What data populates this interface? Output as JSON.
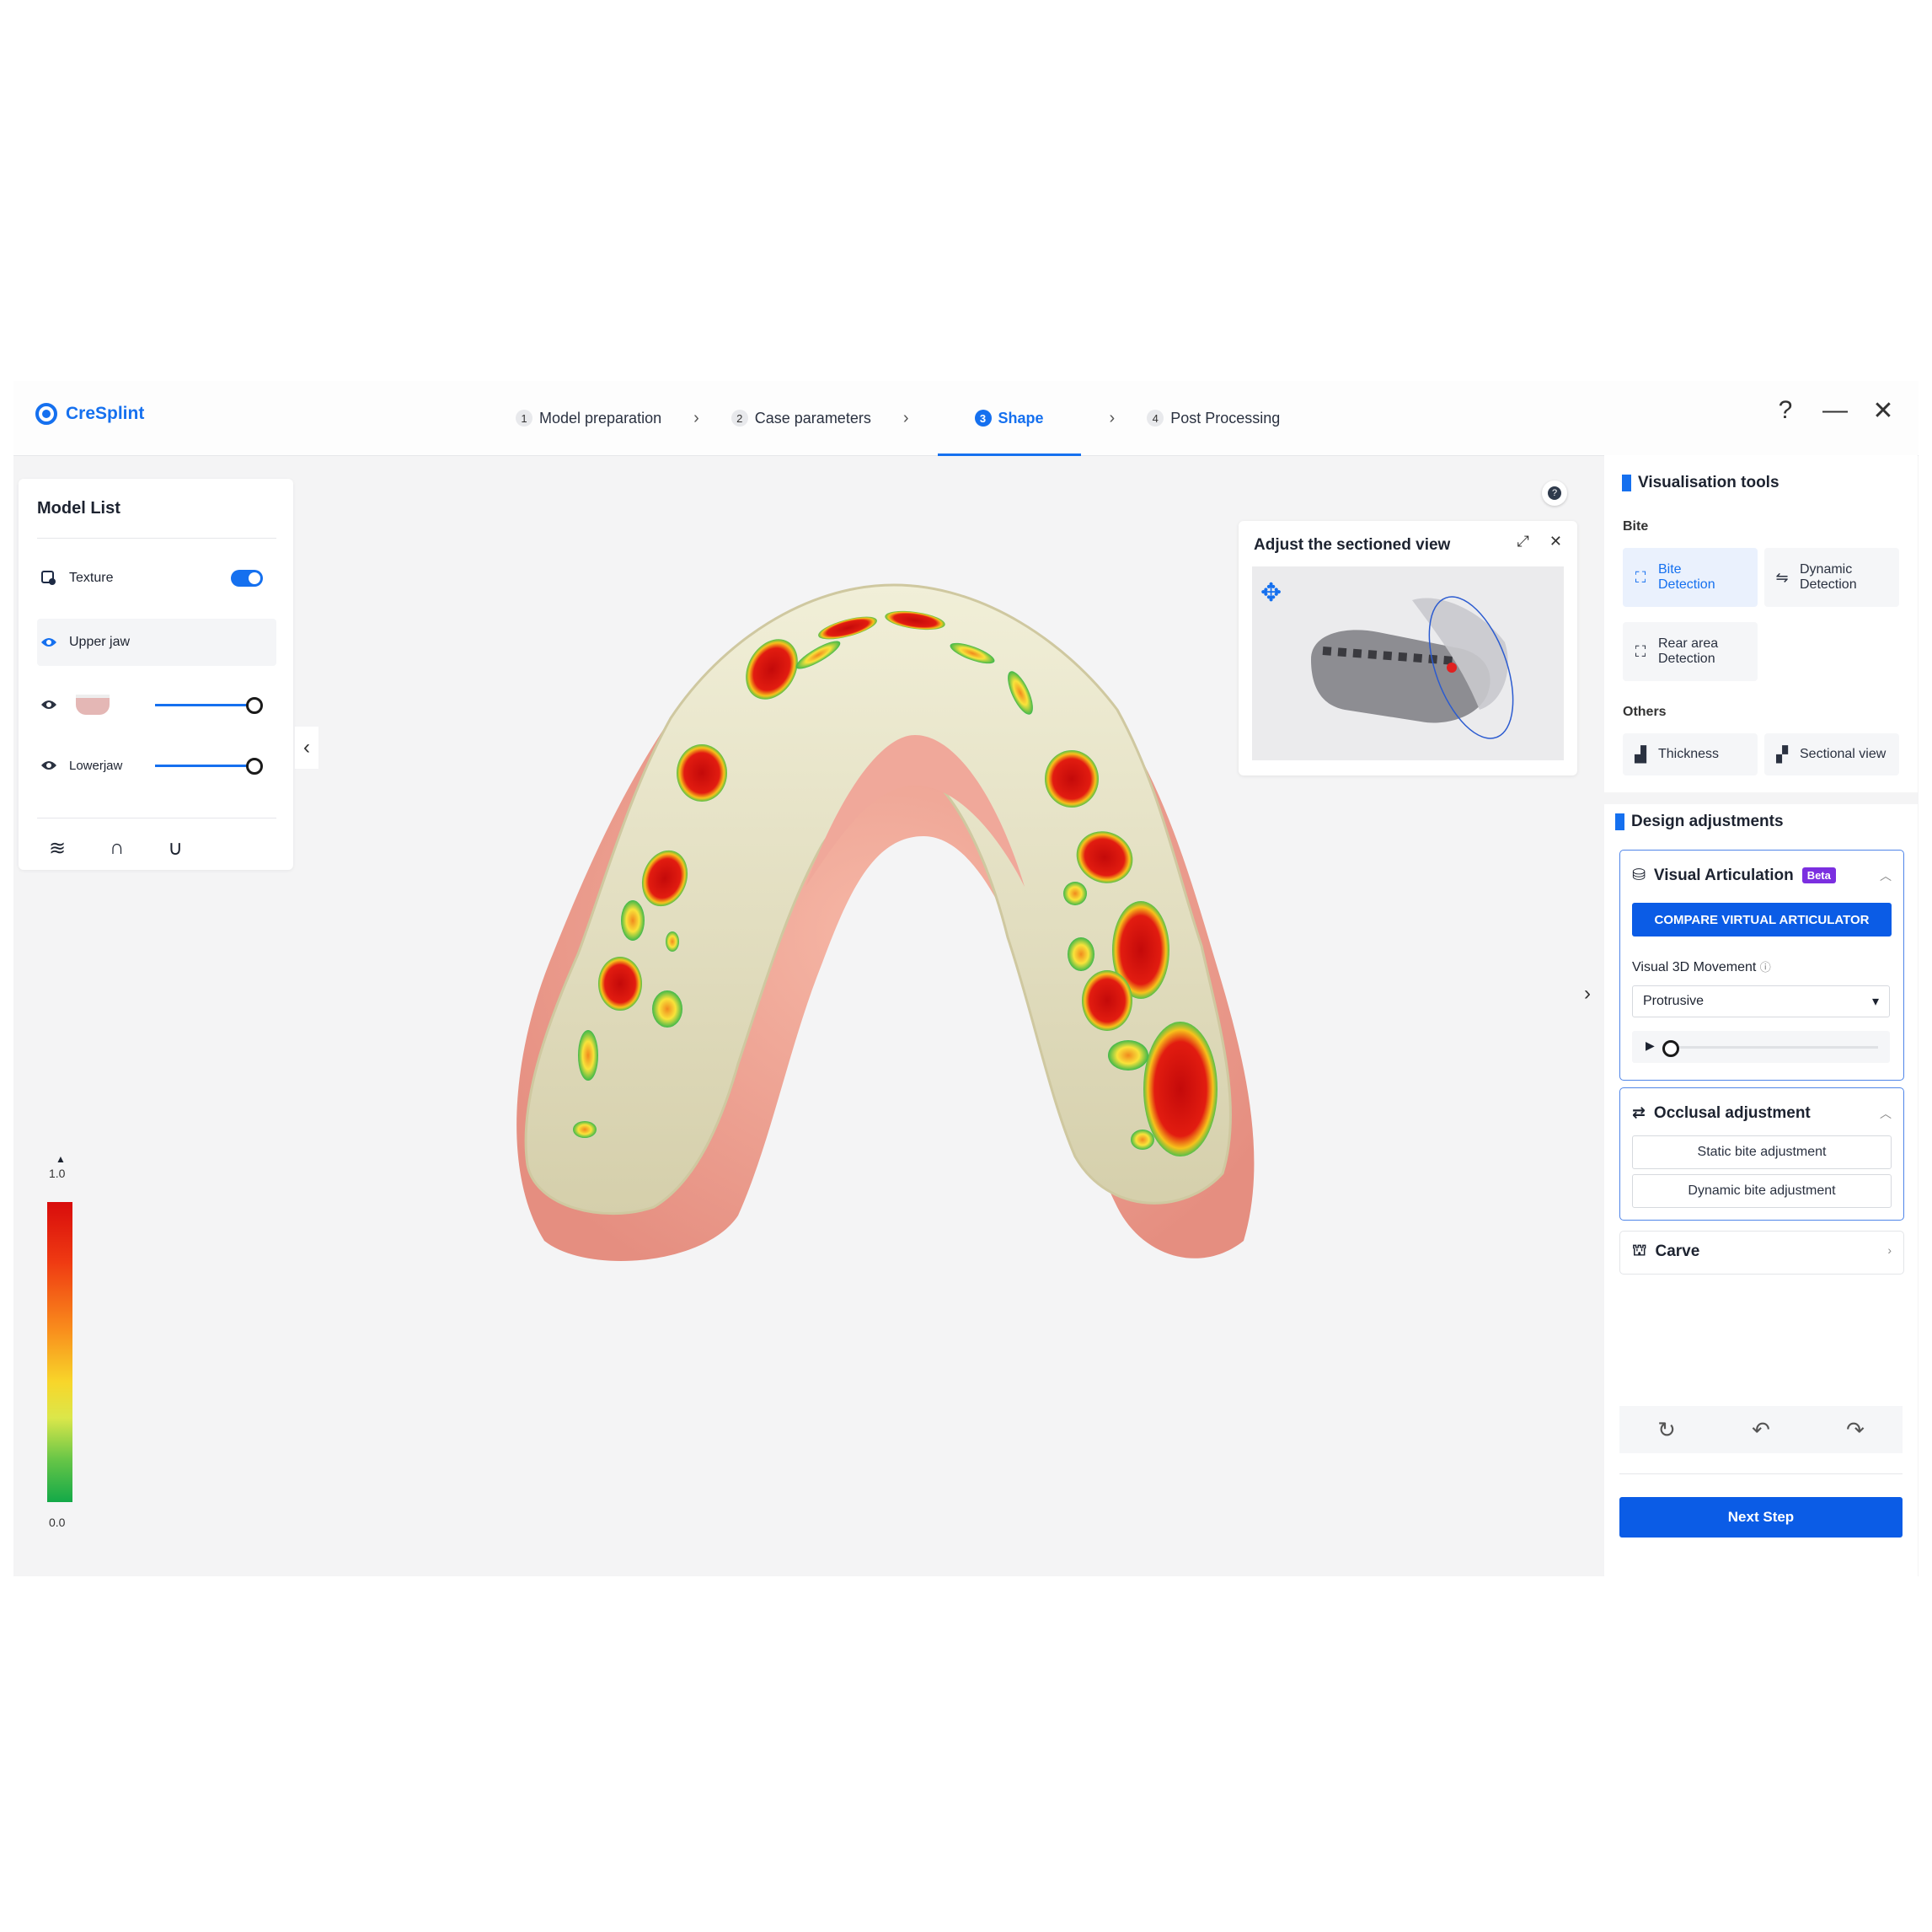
{
  "app": {
    "name": "CreSplint"
  },
  "steps": [
    {
      "num": "1",
      "label": "Model preparation"
    },
    {
      "num": "2",
      "label": "Case parameters"
    },
    {
      "num": "3",
      "label": "Shape"
    },
    {
      "num": "4",
      "label": "Post Processing"
    }
  ],
  "active_step": 3,
  "window_controls": {
    "help": "?",
    "minimize": "—",
    "close": "✕"
  },
  "model_list": {
    "title": "Model List",
    "texture_label": "Texture",
    "texture_on": true,
    "upper_jaw_label": "Upper jaw",
    "lower_jaw_label": "Lowerjaw",
    "upper_opacity": 1.0,
    "lower_opacity": 1.0
  },
  "sectioned_view": {
    "title": "Adjust the sectioned view"
  },
  "visualisation": {
    "title": "Visualisation tools",
    "bite_label": "Bite",
    "bite_detection": [
      "Bite",
      "Detection"
    ],
    "dynamic_detection": [
      "Dynamic",
      "Detection"
    ],
    "rear_area_detection": [
      "Rear area",
      "Detection"
    ],
    "others_label": "Others",
    "thickness": "Thickness",
    "sectional_view": "Sectional view"
  },
  "design": {
    "title": "Design adjustments",
    "visual_articulation": "Visual Articulation",
    "beta": "Beta",
    "compare_button": "COMPARE VIRTUAL ARTICULATOR",
    "movement_label": "Visual 3D Movement",
    "movement_value": "Protrusive",
    "movement_progress": 0,
    "occlusal_title": "Occlusal adjustment",
    "static_bite": "Static bite adjustment",
    "dynamic_bite": "Dynamic bite adjustment",
    "carve": "Carve"
  },
  "next_step": "Next Step",
  "legend": {
    "max": "1.0",
    "min": "0.0"
  },
  "colors": {
    "accent": "#1570ef",
    "primary_button": "#0b5ce6",
    "beta": "#7b2fe0"
  }
}
